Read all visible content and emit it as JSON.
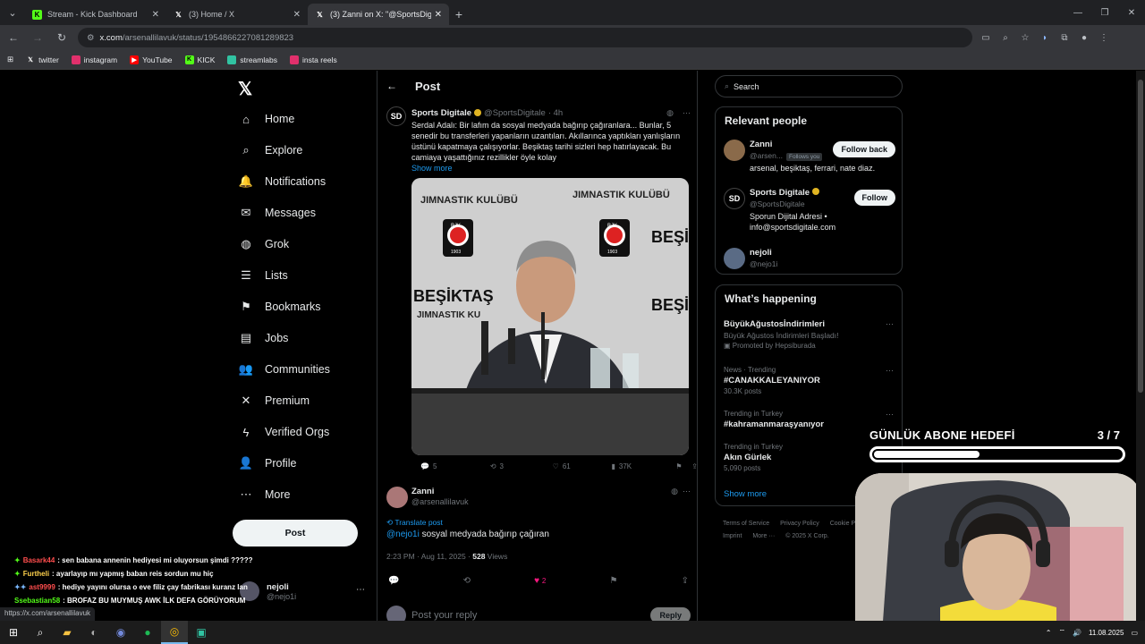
{
  "browser": {
    "tabs": [
      {
        "title": "Stream - Kick Dashboard",
        "icon": "kick-icon",
        "active": false
      },
      {
        "title": "(3) Home / X",
        "icon": "x-icon",
        "active": false
      },
      {
        "title": "(3) Zanni on X: \"@SportsDigitale",
        "icon": "x-icon",
        "active": true
      }
    ],
    "url_host": "x.com",
    "url_path": "/arsenallilavuk/status/1954866227081289823",
    "bookmarks": [
      {
        "label": "twitter",
        "color": "#000000"
      },
      {
        "label": "instagram",
        "color": "#e1306c"
      },
      {
        "label": "YouTube",
        "color": "#ff0000"
      },
      {
        "label": "KICK",
        "color": "#53fc18"
      },
      {
        "label": "streamlabs",
        "color": "#31c3a2"
      },
      {
        "label": "insta reels",
        "color": "#e1306c"
      }
    ],
    "status_url": "https://x.com/arsenallilavuk"
  },
  "nav": {
    "items": [
      {
        "label": "Home",
        "icon": "home-icon",
        "glyph": "⌂"
      },
      {
        "label": "Explore",
        "icon": "search-icon",
        "glyph": "⌕"
      },
      {
        "label": "Notifications",
        "icon": "bell-icon",
        "glyph": "🔔"
      },
      {
        "label": "Messages",
        "icon": "mail-icon",
        "glyph": "✉"
      },
      {
        "label": "Grok",
        "icon": "grok-icon",
        "glyph": "◍"
      },
      {
        "label": "Lists",
        "icon": "list-icon",
        "glyph": "☰"
      },
      {
        "label": "Bookmarks",
        "icon": "bookmark-icon",
        "glyph": "⚑"
      },
      {
        "label": "Jobs",
        "icon": "briefcase-icon",
        "glyph": "▤"
      },
      {
        "label": "Communities",
        "icon": "people-icon",
        "glyph": "👥"
      },
      {
        "label": "Premium",
        "icon": "x-icon",
        "glyph": "✕"
      },
      {
        "label": "Verified Orgs",
        "icon": "lightning-icon",
        "glyph": "ϟ"
      },
      {
        "label": "Profile",
        "icon": "person-icon",
        "glyph": "👤"
      },
      {
        "label": "More",
        "icon": "more-icon",
        "glyph": "⋯"
      }
    ],
    "post_label": "Post",
    "account": {
      "name": "nejoli",
      "handle": "@nejo1i"
    }
  },
  "post": {
    "header": "Post",
    "tweet": {
      "name": "Sports Digitale",
      "handle": "@SportsDigitale",
      "time": "· 4h",
      "text": "Serdal Adalı: Bir lafım da sosyal medyada bağırıp çağıranlara... Bunlar, 5 senedir bu transferleri yapanların uzantıları. Akıllarınca yaptıkları yanlışların üstünü kapatmaya çalışıyorlar. Beşiktaş tarihi sizleri hep hatırlayacak. Bu camiaya yaşattığınız rezillikler öyle kolay",
      "show_more": "Show more",
      "media_text": [
        "JIMNASTIK KULÜBÜ",
        "JIMNASTIK KULÜBÜ",
        "BEŞİ",
        "BEŞİKTAŞ",
        "JIMNASTIK KU",
        "BEŞİ",
        "BJK",
        "1903",
        "BJK",
        "1903"
      ],
      "replies": "5",
      "reposts": "3",
      "likes": "61",
      "views": "37K"
    },
    "reply": {
      "name": "Zanni",
      "handle": "@arsenallilavuk",
      "translate": "Translate post",
      "mention": "@nejo1i",
      "text": " sosyal medyada bağırıp çağıran",
      "date": "2:23 PM · Aug 11, 2025 · ",
      "views_count": "528",
      "views_label": " Views",
      "likes": "2"
    },
    "compose_placeholder": "Post your reply",
    "reply_button": "Reply"
  },
  "sidebar": {
    "search_placeholder": "Search",
    "relevant_title": "Relevant people",
    "people": [
      {
        "name": "Zanni",
        "handle": "@arsen...",
        "follows_you": "Follows you",
        "bio": "arsenal, beşiktaş, ferrari, nate diaz.",
        "button": "Follow back",
        "color": "#8a6a4a"
      },
      {
        "name": "Sports Digitale",
        "handle": "@SportsDigitale",
        "bio": "Sporun Dijital Adresi • info@sportsdigitale.com",
        "button": "Follow",
        "color": "#000000"
      },
      {
        "name": "nejoli",
        "handle": "@nejo1i",
        "color": "#5a6b85"
      }
    ],
    "happening_title": "What’s happening",
    "trends": [
      {
        "context": "",
        "title": "BüyükAğustosİndirimleri",
        "sub": "Büyük Ağustos İndirimleri Başladı!",
        "count": "Promoted by Hepsiburada"
      },
      {
        "context": "News · Trending",
        "title": "#CANAKKALEYANIYOR",
        "sub": "",
        "count": "30.3K posts"
      },
      {
        "context": "Trending in Turkey",
        "title": "#kahramanmaraşyanıyor",
        "sub": "",
        "count": ""
      },
      {
        "context": "Trending in Turkey",
        "title": "Akın Gürlek",
        "sub": "",
        "count": "5,090 posts"
      }
    ],
    "show_more": "Show more",
    "footer": [
      "Terms of Service",
      "Privacy Policy",
      "Cookie Po",
      "Imprint",
      "More ···",
      "© 2025 X Corp."
    ]
  },
  "chat": [
    {
      "user": "Basark44",
      "color": "#ff4d4d",
      "msg": ": sen babana annenin hediyesi mi oluyorsun şimdi ?????",
      "badge": "✦"
    },
    {
      "user": "Furtheli",
      "color": "#ffd24d",
      "msg": ": ayarlayıp mı yapmış baban reis sordun mu hiç",
      "badge": "✦"
    },
    {
      "user": "ast9999",
      "color": "#ff4d4d",
      "msg": ": hediye yayını olursa o eve filiz çay fabrikası kuranz lan",
      "badge": "✦✦"
    },
    {
      "user": "Ssebastian58",
      "color": "#53fc18",
      "msg": ": BROFAZ BU MUYMUŞ AWK İLK DEFA GÖRÜYORUM",
      "badge": ""
    }
  ],
  "overlay": {
    "goal_label": "GÜNLÜK ABONE HEDEFİ",
    "goal_current": 3,
    "goal_target": 7,
    "goal_text": "3  / 7"
  },
  "taskbar": {
    "date": "11.08.2025"
  }
}
